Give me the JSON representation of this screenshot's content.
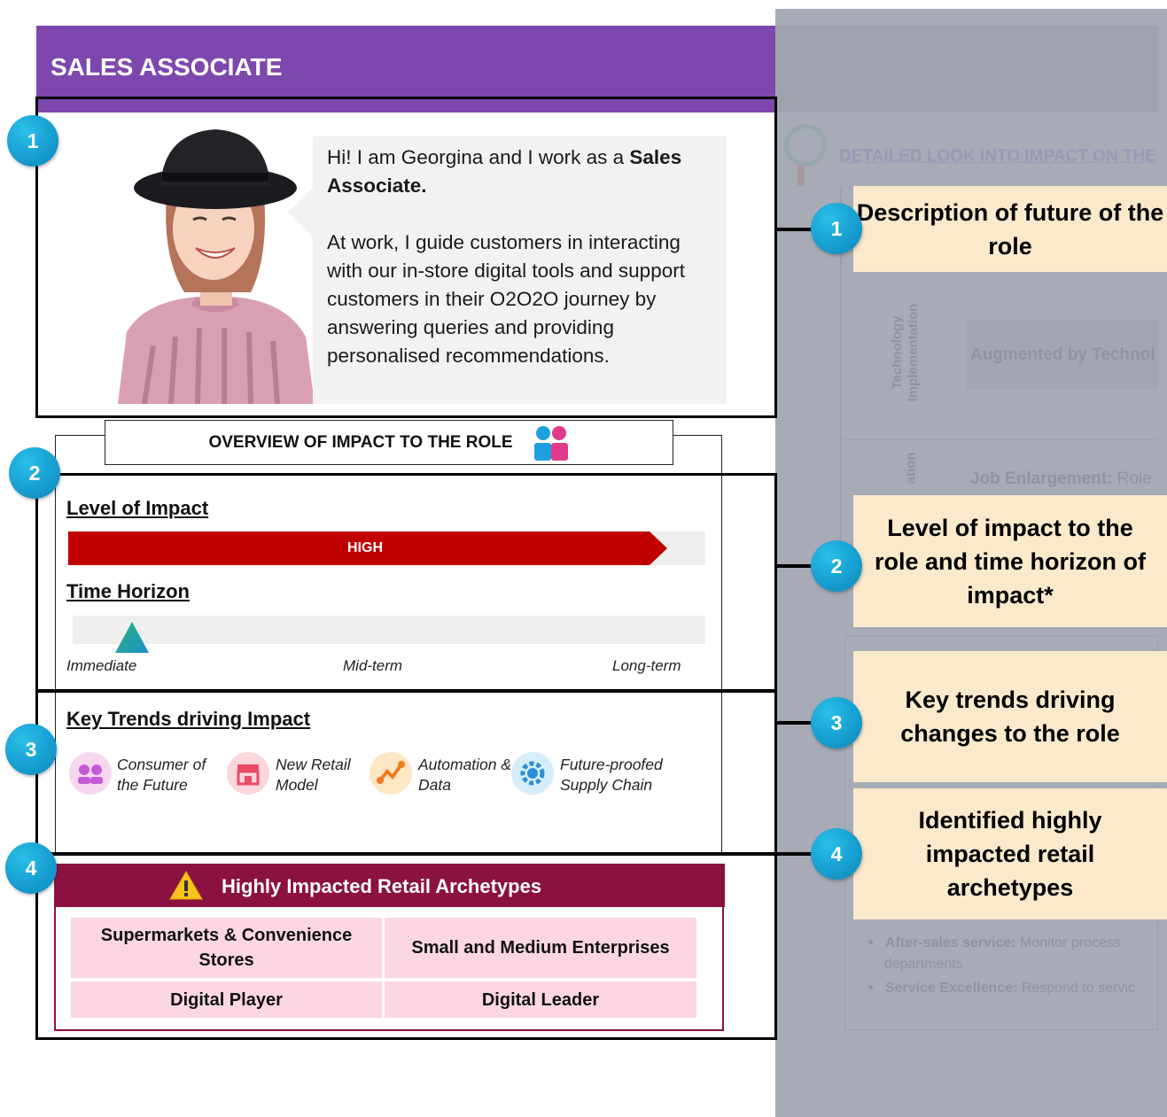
{
  "header": {
    "title": "SALES ASSOCIATE"
  },
  "bubble": {
    "intro_before": "Hi! I am Georgina and I work as a ",
    "intro_bold": "Sales Associate.",
    "body": "At work, I guide customers in interacting with our in-store digital tools and support customers in their O2O2O journey by answering queries and providing personalised recommendations."
  },
  "overview": {
    "title": "OVERVIEW OF IMPACT TO THE ROLE",
    "icon": "people-icon"
  },
  "impact": {
    "heading": "Level of Impact",
    "level_label": "HIGH",
    "level_fraction": 0.94,
    "color": "#c00000"
  },
  "time_horizon": {
    "heading": "Time Horizon",
    "marker_fraction": 0.08,
    "ticks": [
      "Immediate",
      "Mid-term",
      "Long-term"
    ]
  },
  "trends": {
    "heading": "Key Trends driving Impact",
    "items": [
      {
        "line1": "Consumer of",
        "line2": "the Future",
        "icon": "consumer-icon"
      },
      {
        "line1": "New Retail",
        "line2": "Model",
        "icon": "store-icon"
      },
      {
        "line1": "Automation &",
        "line2": "Data",
        "icon": "automation-icon"
      },
      {
        "line1": "Future-proofed",
        "line2": "Supply Chain",
        "icon": "supply-chain-icon"
      }
    ]
  },
  "archetypes": {
    "title": "Highly Impacted Retail Archetypes",
    "warning_icon": "warning-icon",
    "cells": [
      "Supermarkets & Convenience Stores",
      "Small and Medium Enterprises",
      "Digital Player",
      "Digital Leader"
    ]
  },
  "badges": [
    "1",
    "2",
    "3",
    "4"
  ],
  "callouts": [
    "Description of future of the role",
    "Level of impact to the role and time horizon of impact*",
    "Key trends driving changes to the role",
    "Identified highly impacted retail archetypes"
  ],
  "background_panel": {
    "title": "DETAILED LOOK INTO IMPACT ON THE",
    "vertical_label_1": "Technology Implementation",
    "vertical_label_2": "ation",
    "row_1": "Augmented by Technol",
    "row_2_label": "Job Enlargement:",
    "row_2_text": "Role",
    "bullet_1_label": "After-sales service:",
    "bullet_1_text": "Monitor process",
    "bullet_1_cont": "departments",
    "bullet_2_label": "Service Excellence:",
    "bullet_2_text": "Respond to servic"
  }
}
